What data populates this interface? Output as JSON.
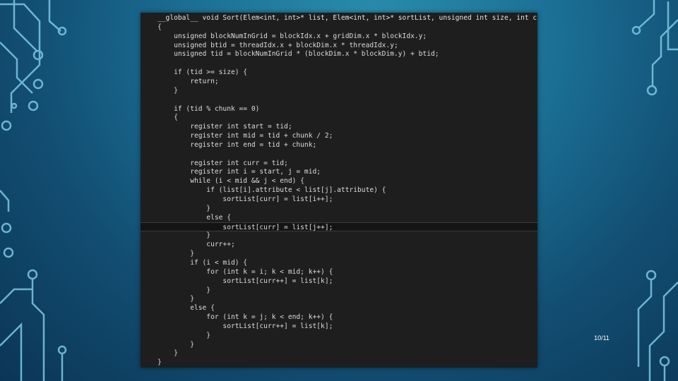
{
  "slide": {
    "page_number": "10/11",
    "background_colors": [
      "#2a8fb0",
      "#1b6f95",
      "#0b3556"
    ],
    "decoration": "circuit-traces"
  },
  "code": {
    "lines": [
      "__global__ void Sort(Elem<int, int>* list, Elem<int, int>* sortList, unsigned int size, int chunk)",
      "{",
      "    unsigned blockNumInGrid = blockIdx.x + gridDim.x * blockIdx.y;",
      "    unsigned btid = threadIdx.x + blockDim.x * threadIdx.y;",
      "    unsigned tid = blockNumInGrid * (blockDim.x * blockDim.y) + btid;",
      "",
      "    if (tid >= size) {",
      "        return;",
      "    }",
      "",
      "    if (tid % chunk == 0)",
      "    {",
      "        register int start = tid;",
      "        register int mid = tid + chunk / 2;",
      "        register int end = tid + chunk;",
      "",
      "        register int curr = tid;",
      "        register int i = start, j = mid;",
      "        while (i < mid && j < end) {",
      "            if (list[i].attribute < list[j].attribute) {",
      "                sortList[curr] = list[i++];",
      "            }",
      "            else {",
      "                sortList[curr] = list[j++];",
      "            }",
      "            curr++;",
      "        }",
      "        if (i < mid) {",
      "            for (int k = i; k < mid; k++) {",
      "                sortList[curr++] = list[k];",
      "            }",
      "        }",
      "        else {",
      "            for (int k = j; k < end; k++) {",
      "                sortList[curr++] = list[k];",
      "            }",
      "        }",
      "    }",
      "}"
    ],
    "highlighted_line": 23
  }
}
